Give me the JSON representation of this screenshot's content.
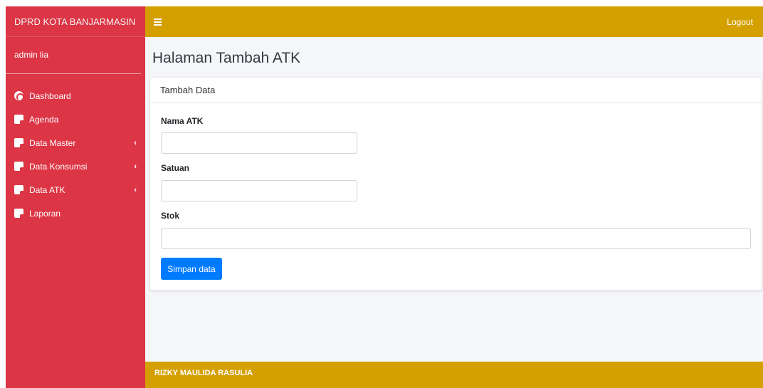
{
  "sidebar": {
    "brand": "DPRD KOTA BANJARMASIN",
    "user": "admin lia",
    "items": [
      {
        "label": "Dashboard",
        "icon": "dashboard-icon",
        "has_submenu": false
      },
      {
        "label": "Agenda",
        "icon": "note-icon",
        "has_submenu": false
      },
      {
        "label": "Data Master",
        "icon": "note-icon",
        "has_submenu": true
      },
      {
        "label": "Data Konsumsi",
        "icon": "note-icon",
        "has_submenu": true
      },
      {
        "label": "Data ATK",
        "icon": "note-icon",
        "has_submenu": true
      },
      {
        "label": "Laporan",
        "icon": "note-icon",
        "has_submenu": false
      }
    ],
    "submenu_indicator": "‹"
  },
  "topbar": {
    "menu_icon": "hamburger-icon",
    "logout_label": "Logout"
  },
  "page": {
    "title": "Halaman Tambah ATK"
  },
  "form": {
    "card_title": "Tambah Data",
    "fields": [
      {
        "label": "Nama ATK",
        "value": "",
        "placeholder": ""
      },
      {
        "label": "Satuan",
        "value": "",
        "placeholder": ""
      },
      {
        "label": "Stok",
        "value": "",
        "placeholder": ""
      }
    ],
    "submit_label": "Simpan data"
  },
  "footer": {
    "text": "RIZKY MAULIDA RASULIA"
  },
  "colors": {
    "sidebar_bg": "#dc3545",
    "header_bg": "#d4a000",
    "primary_button": "#007bff"
  }
}
